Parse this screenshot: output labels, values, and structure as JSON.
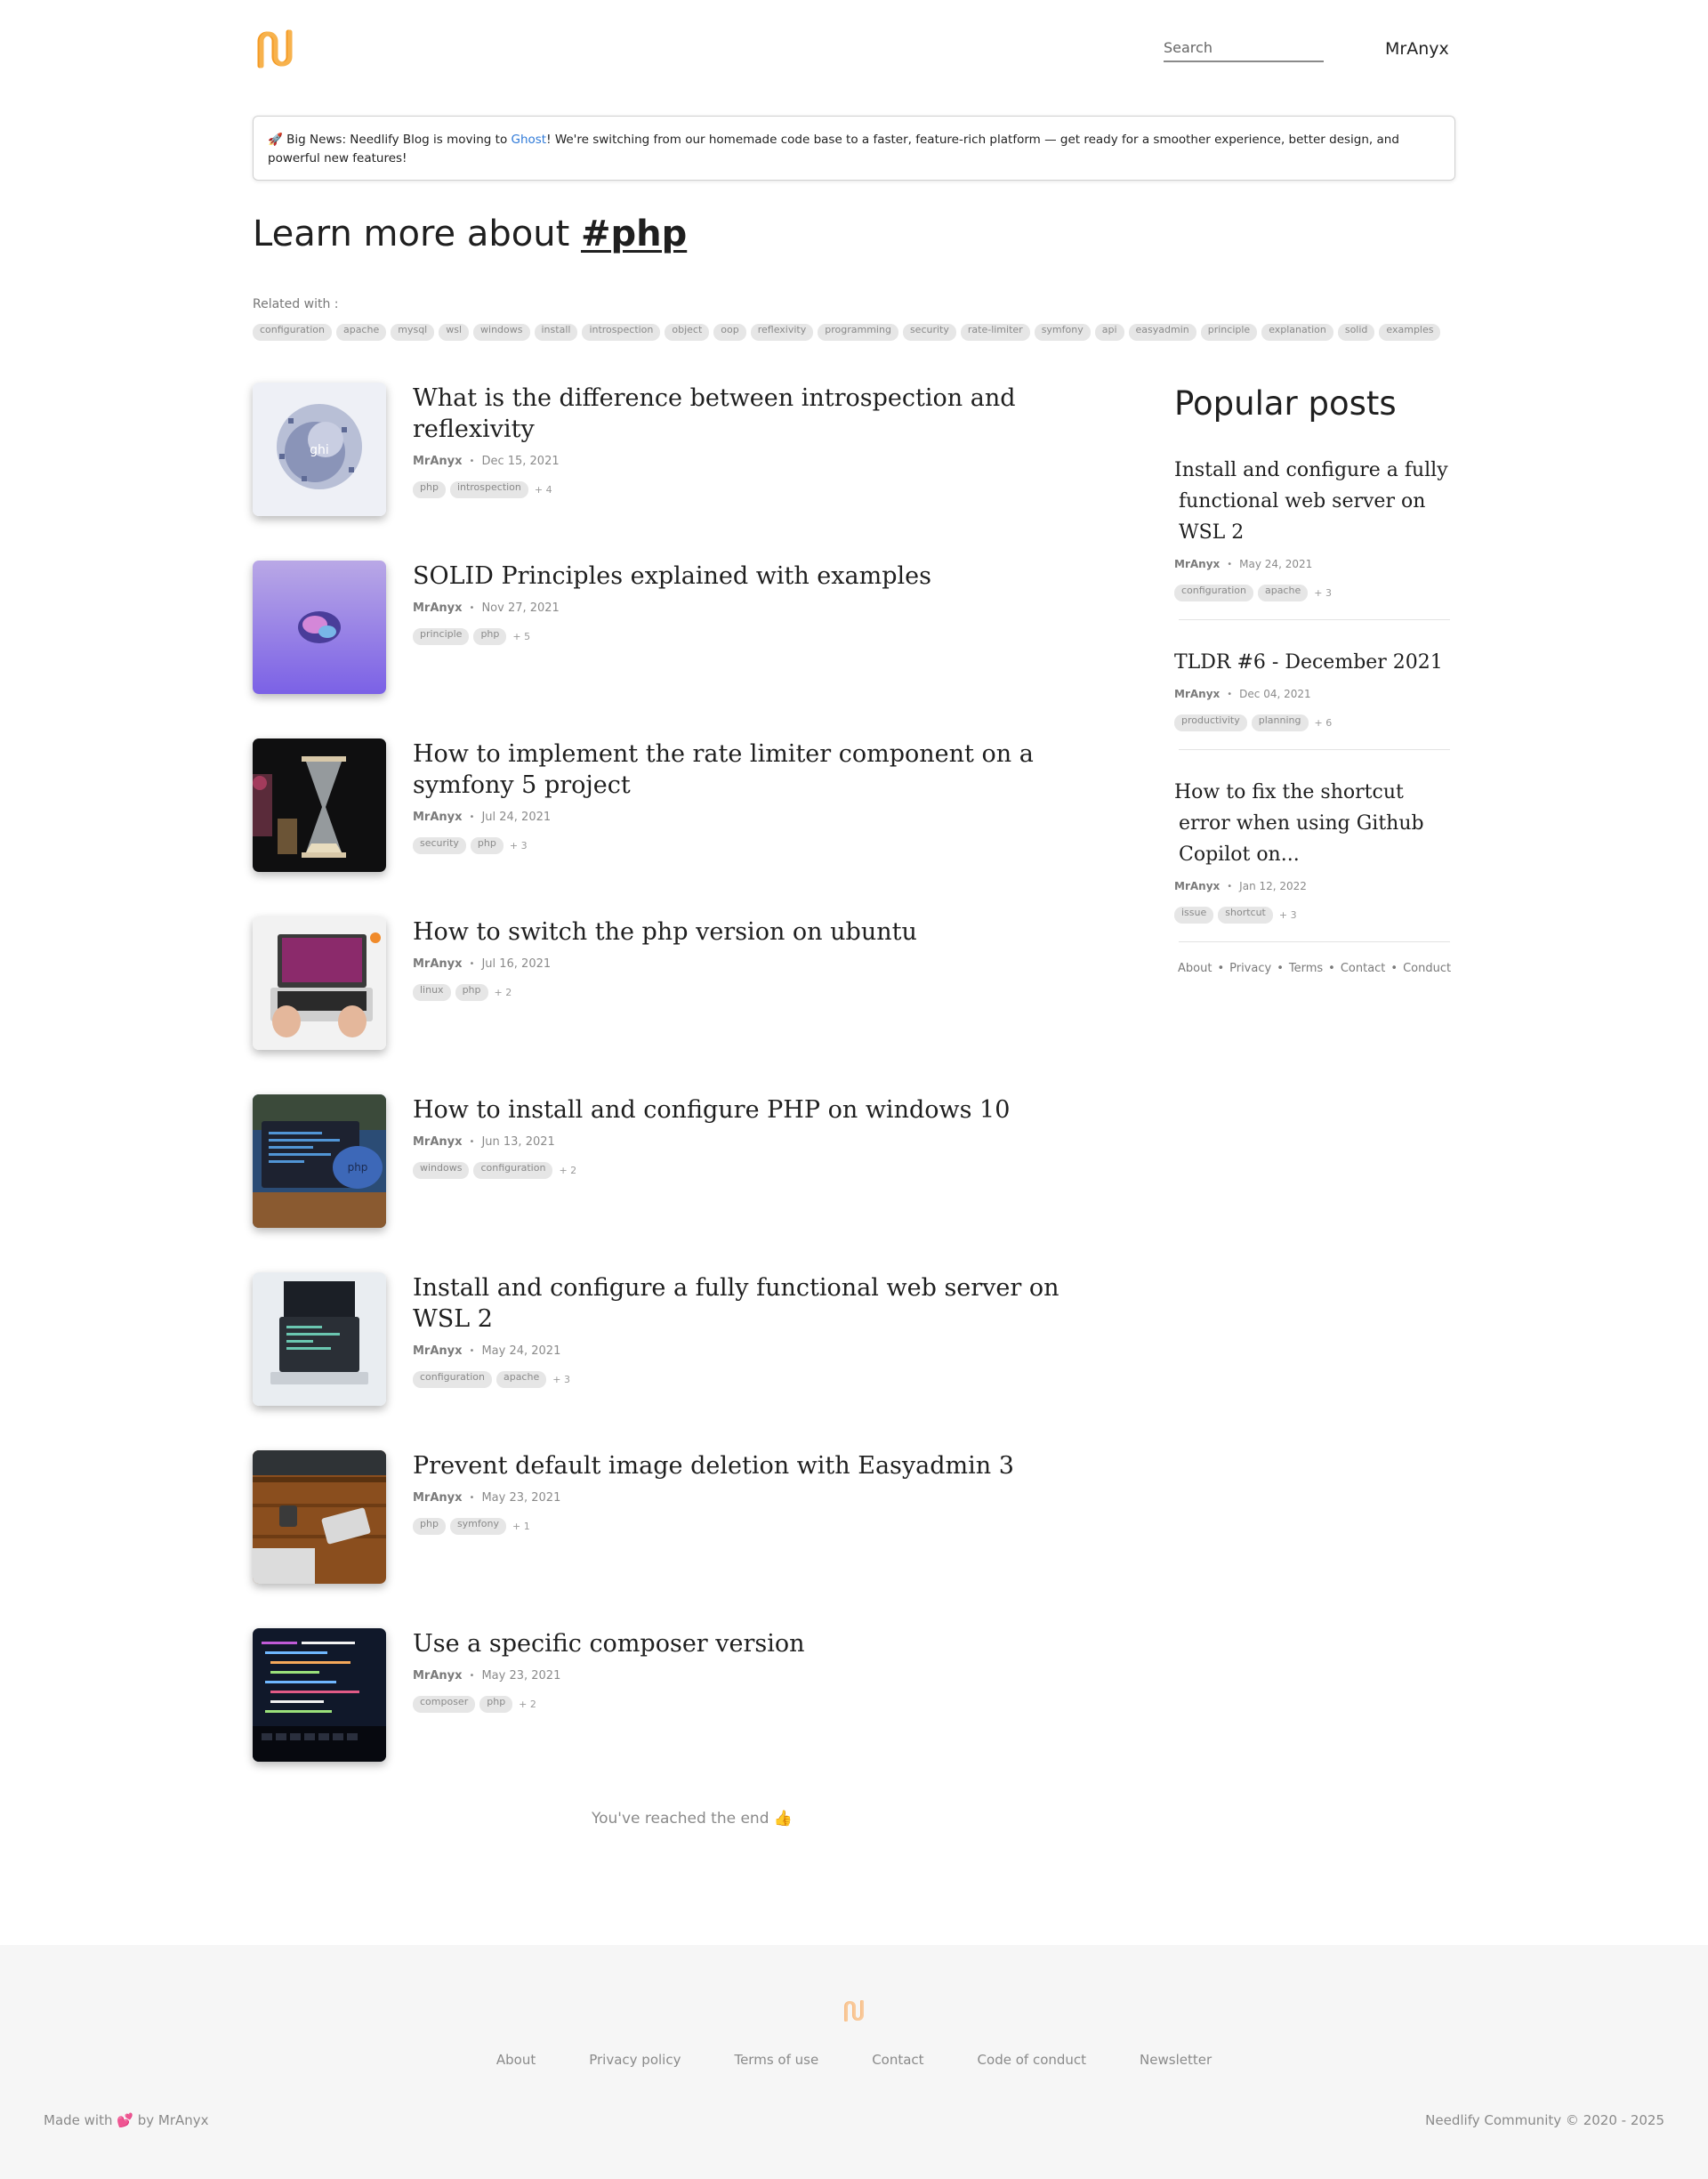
{
  "brand": {
    "logo_icon": "needlify-logo-icon",
    "accent": "#f59a23"
  },
  "header": {
    "search_placeholder": "Search",
    "user": "MrAnyx"
  },
  "banner": {
    "emoji": "🚀",
    "text_before": "Big News: Needlify Blog is moving to ",
    "link": "Ghost",
    "text_after": "! We're switching from our homemade code base to a faster, feature-rich platform — get ready for a smoother experience, better design, and powerful new features!"
  },
  "title": {
    "prefix": "Learn more about ",
    "tag": "#php"
  },
  "related": {
    "label": "Related with :",
    "tags": [
      "configuration",
      "apache",
      "mysql",
      "wsl",
      "windows",
      "install",
      "introspection",
      "object",
      "oop",
      "reflexivity",
      "programming",
      "security",
      "rate-limiter",
      "symfony",
      "api",
      "easyadmin",
      "principle",
      "explanation",
      "solid",
      "examples"
    ]
  },
  "posts": [
    {
      "title": "What is the difference between introspection and reflexivity",
      "author": "MrAnyx",
      "date": "Dec 15, 2021",
      "tags": [
        "php",
        "introspection"
      ],
      "more": "+ 4",
      "thumb": "cube-cluster-image"
    },
    {
      "title": "SOLID Principles explained with examples",
      "author": "MrAnyx",
      "date": "Nov 27, 2021",
      "tags": [
        "principle",
        "php"
      ],
      "more": "+ 5",
      "thumb": "brain-image"
    },
    {
      "title": "How to implement the rate limiter component on a symfony 5 project",
      "author": "MrAnyx",
      "date": "Jul 24, 2021",
      "tags": [
        "security",
        "php"
      ],
      "more": "+ 3",
      "thumb": "hourglass-image"
    },
    {
      "title": "How to switch the php version on ubuntu",
      "author": "MrAnyx",
      "date": "Jul 16, 2021",
      "tags": [
        "linux",
        "php"
      ],
      "more": "+ 2",
      "thumb": "laptop-hands-image"
    },
    {
      "title": "How to install and configure PHP on windows 10",
      "author": "MrAnyx",
      "date": "Jun 13, 2021",
      "tags": [
        "windows",
        "configuration"
      ],
      "more": "+ 2",
      "thumb": "php-elephant-image"
    },
    {
      "title": "Install and configure a fully functional web server on WSL 2",
      "author": "MrAnyx",
      "date": "May 24, 2021",
      "tags": [
        "configuration",
        "apache"
      ],
      "more": "+ 3",
      "thumb": "desk-laptop-image"
    },
    {
      "title": "Prevent default image deletion with Easyadmin 3",
      "author": "MrAnyx",
      "date": "May 23, 2021",
      "tags": [
        "php",
        "symfony"
      ],
      "more": "+ 1",
      "thumb": "wood-desk-image"
    },
    {
      "title": "Use a specific composer version",
      "author": "MrAnyx",
      "date": "May 23, 2021",
      "tags": [
        "composer",
        "php"
      ],
      "more": "+ 2",
      "thumb": "code-screen-image"
    }
  ],
  "end_message": "You've reached the end 👍",
  "sidebar": {
    "title": "Popular posts",
    "items": [
      {
        "title": "Install and configure a fully functional web server on WSL 2",
        "author": "MrAnyx",
        "date": "May 24, 2021",
        "tags": [
          "configuration",
          "apache"
        ],
        "more": "+ 3"
      },
      {
        "title": "TLDR #6 - December 2021",
        "author": "MrAnyx",
        "date": "Dec 04, 2021",
        "tags": [
          "productivity",
          "planning"
        ],
        "more": "+ 6"
      },
      {
        "title": "How to fix the shortcut error when using Github Copilot on...",
        "author": "MrAnyx",
        "date": "Jan 12, 2022",
        "tags": [
          "issue",
          "shortcut"
        ],
        "more": "+ 3"
      }
    ],
    "links": [
      "About",
      "Privacy",
      "Terms",
      "Contact",
      "Conduct"
    ]
  },
  "footer": {
    "nav": [
      "About",
      "Privacy policy",
      "Terms of use",
      "Contact",
      "Code of conduct",
      "Newsletter"
    ],
    "made_prefix": "Made with",
    "made_heart": "💕",
    "made_suffix": "by MrAnyx",
    "copyright": "Needlify Community © 2020 - 2025"
  }
}
